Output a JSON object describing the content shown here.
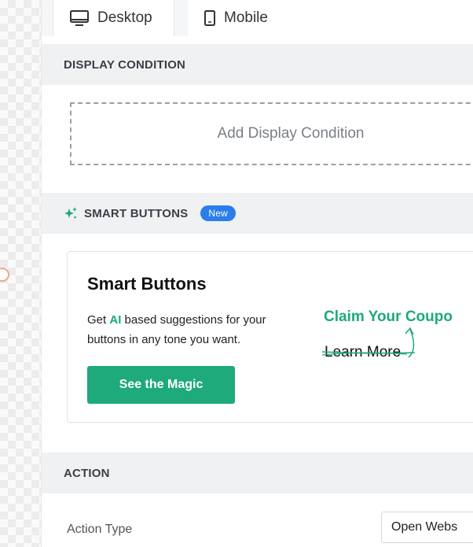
{
  "tabs": {
    "desktop": {
      "label": "Desktop",
      "icon": "monitor-icon"
    },
    "mobile": {
      "label": "Mobile",
      "icon": "phone-icon"
    }
  },
  "display_condition": {
    "header": "DISPLAY CONDITION",
    "add_label": "Add Display Condition"
  },
  "smart_buttons": {
    "header": "SMART BUTTONS",
    "badge": "New",
    "icon": "sparkle-icon",
    "card": {
      "title": "Smart Buttons",
      "text_prefix": "Get ",
      "text_ai": "AI",
      "text_suffix": " based suggestions for your buttons in any tone you want.",
      "button_label": "See the Magic",
      "preview_claim": "Claim Your Coupo",
      "preview_learn": "Learn More"
    }
  },
  "action": {
    "header": "ACTION",
    "type_label": "Action Type",
    "type_value": "Open Webs"
  },
  "colors": {
    "accent_green": "#1eaa7a",
    "badge_blue": "#2b7de9",
    "section_bg": "#f0f1f3"
  }
}
